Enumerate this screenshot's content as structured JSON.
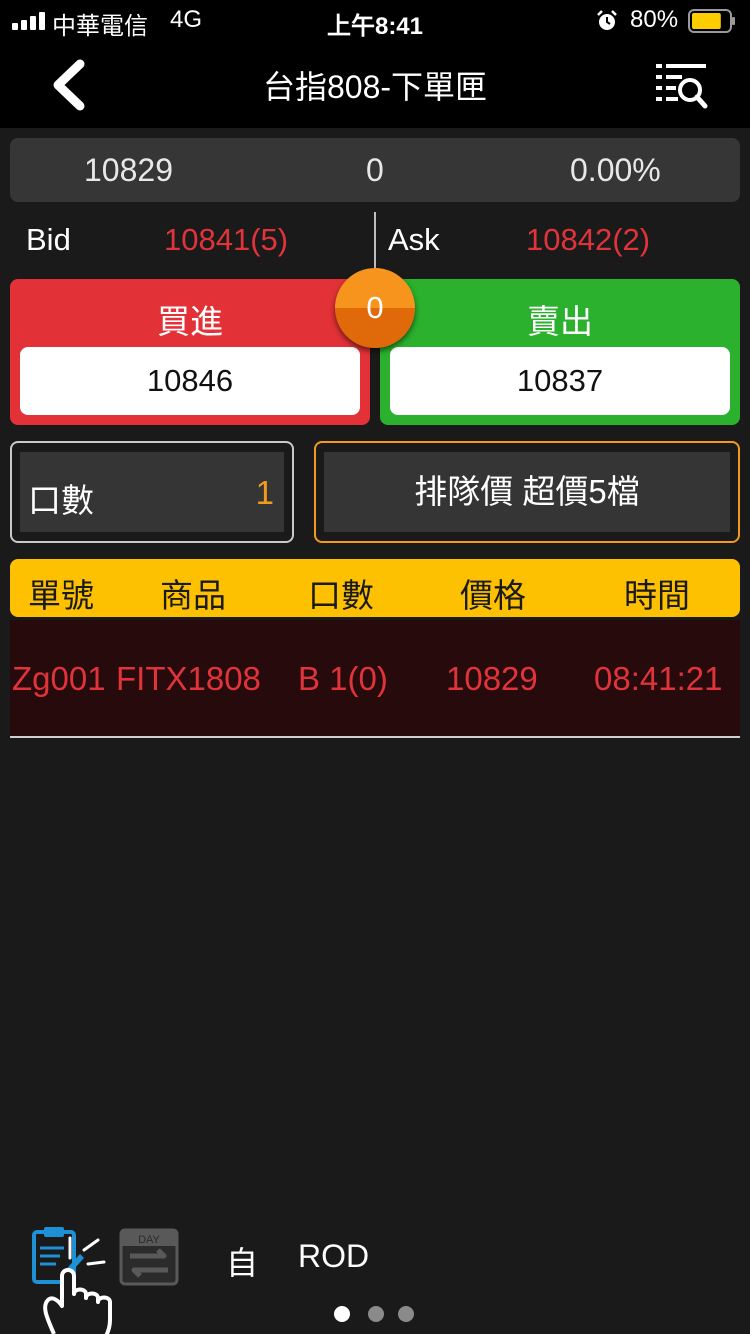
{
  "status_bar": {
    "carrier": "中華電信",
    "network": "4G",
    "time": "上午8:41",
    "battery": "80%",
    "battery_level": 0.8,
    "battery_color": "#ffcc00"
  },
  "nav": {
    "title": "台指808-下單匣"
  },
  "quote": {
    "price": "10829",
    "change": "0",
    "change_pct": "0.00%"
  },
  "bid_ask": {
    "bid_label": "Bid",
    "bid_value": "10841(5)",
    "ask_label": "Ask",
    "ask_value": "10842(2)"
  },
  "trade": {
    "buy_label": "買進",
    "buy_price": "10846",
    "sell_label": "賣出",
    "sell_price": "10837",
    "center_value": "0",
    "buy_color": "#e23237",
    "sell_color": "#2bb12d"
  },
  "order": {
    "qty_label": "口數",
    "qty_value": "1",
    "type_label": "排隊價 超價5檔"
  },
  "table": {
    "headers": [
      "單號",
      "商品",
      "口數",
      "價格",
      "時間"
    ],
    "rows": [
      [
        "Zg001",
        "FITX1808",
        "B 1(0)",
        "10829",
        "08:41:21"
      ]
    ]
  },
  "bottom": {
    "mode": "自",
    "tif": "ROD",
    "day_icon_text": "DAY",
    "page_count": 3,
    "active_page": 1
  }
}
